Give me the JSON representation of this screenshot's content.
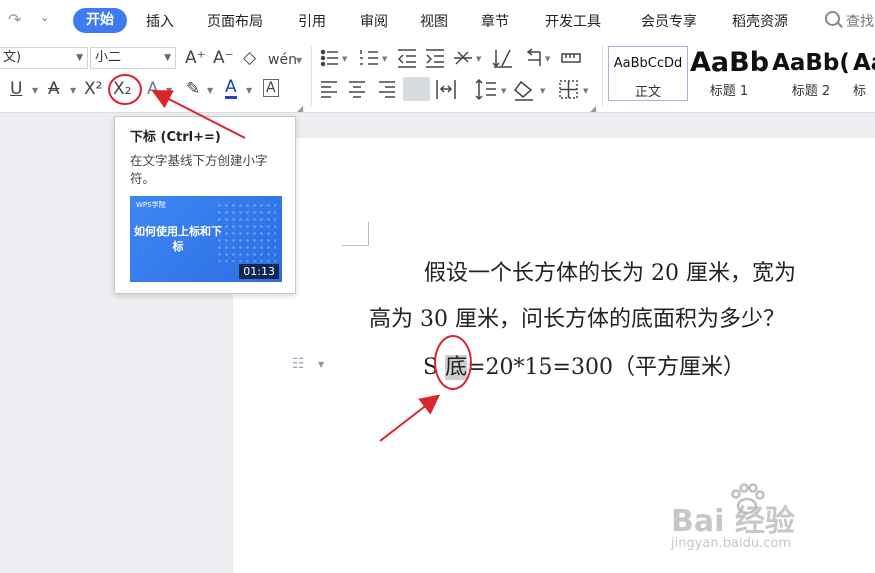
{
  "tabbar": {
    "redo_icon": "redo-icon",
    "quick_dropdown": "⌄",
    "active_tab": "开始",
    "tabs": [
      "插入",
      "页面布局",
      "引用",
      "审阅",
      "视图",
      "章节",
      "开发工具",
      "会员专享",
      "稻壳资源"
    ],
    "search_label": "查找"
  },
  "ribbon": {
    "font_name": "文)",
    "font_size": "小二",
    "font_grow": "A⁺",
    "font_shrink": "A⁻",
    "clear_format": "◇",
    "phonetic": "wén",
    "underline": "U",
    "strikethrough": "A",
    "superscript": "X²",
    "subscript": "X₂",
    "text_effect": "A",
    "highlight": "✎",
    "font_color": "A",
    "char_border": "A",
    "styles": [
      {
        "sample": "AaBbCcDd",
        "name": "正文"
      },
      {
        "sample": "AaBb",
        "name": "标题 1"
      },
      {
        "sample": "AaBb(",
        "name": "标题 2"
      },
      {
        "sample": "Aa",
        "name": "标"
      }
    ]
  },
  "tooltip": {
    "title": "下标 (Ctrl+=)",
    "description": "在文字基线下方创建小字符。",
    "video_brand": "WPS学院",
    "video_title": "如何使用上标和下标",
    "video_duration": "01:13"
  },
  "document": {
    "line1": "假设一个长方体的长为 20 厘米，宽为",
    "line2": "高为 30 厘米，问长方体的底面积为多少？",
    "line3_prefix": "S",
    "line3_selected": "底",
    "line3_suffix": "=20*15=300（平方厘米）"
  },
  "watermark": {
    "logo": "Bai  经验",
    "url": "jingyan.baidu.com"
  },
  "colors": {
    "accent": "#3f7bf0",
    "annotation": "#d9262c"
  }
}
